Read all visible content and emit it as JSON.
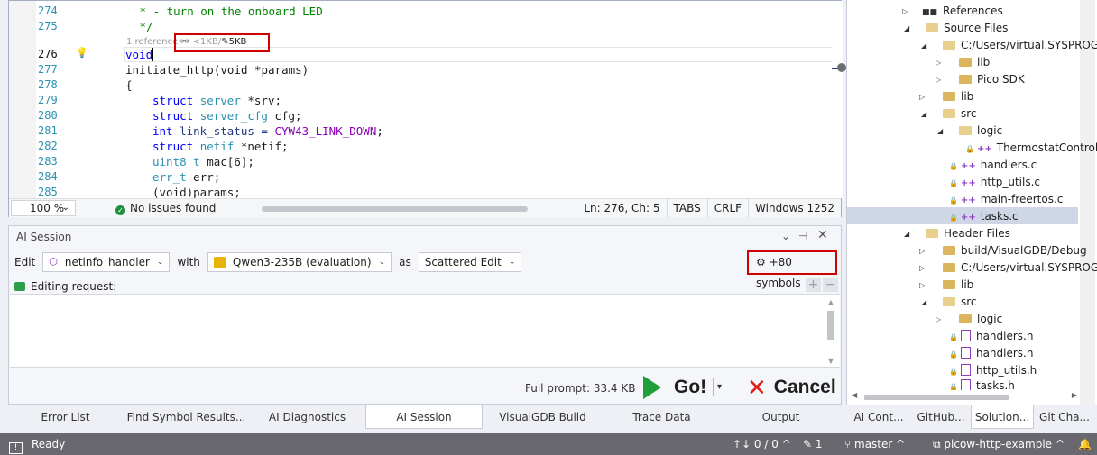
{
  "editor": {
    "line_numbers": [
      "274",
      "275",
      "276",
      "277",
      "278",
      "279",
      "280",
      "281",
      "282",
      "283",
      "284",
      "285"
    ],
    "code_lens": {
      "references": "1 reference",
      "size_before": "<1KB",
      "size_after": "5KB"
    },
    "code": {
      "l274": " * - turn on the onboard LED",
      "l275": " */",
      "l276": "void",
      "l277_fn": "initiate_http",
      "l277_rest": "(void *params)",
      "l278": "{",
      "l279_kw": "struct",
      "l279_ty": "server",
      "l279_rest": " *srv;",
      "l280_kw": "struct",
      "l280_ty": "server_cfg",
      "l280_rest": " cfg;",
      "l281_kw": "int",
      "l281_var": " link_status = ",
      "l281_macro": "CYW43_LINK_DOWN",
      "l281_end": ";",
      "l282_kw": "struct",
      "l282_ty": "netif",
      "l282_rest": " *netif;",
      "l283_ty": "uint8_t",
      "l283_rest": " mac[6];",
      "l284_ty": "err_t",
      "l284_rest": " err;",
      "l285": "(void)params;"
    },
    "status": {
      "zoom": "100 %",
      "issues": "No issues found",
      "position": "Ln: 276, Ch: 5",
      "indent": "TABS",
      "line_ending": "CRLF",
      "encoding": "Windows 1252"
    }
  },
  "ai_session": {
    "title": "AI Session",
    "edit_label": "Edit",
    "symbol": "netinfo_handler",
    "with_label": "with",
    "model": "Qwen3-235B (evaluation)",
    "as_label": "as",
    "mode": "Scattered Edit",
    "symbols_button": "+80 symbols",
    "editing_request": "Editing request:",
    "full_prompt": "Full prompt: 33.4 KB",
    "go_label": "Go!",
    "cancel_label": "Cancel"
  },
  "bottom_tabs": [
    "Error List",
    "Find Symbol Results...",
    "AI Diagnostics",
    "AI Session",
    "VisualGDB Build",
    "Trace Data",
    "Output"
  ],
  "solution_explorer": {
    "items": {
      "references": "References",
      "source_files": "Source Files",
      "users_path": "C:/Users/virtual.SYSPROG",
      "lib1": "lib",
      "pico_sdk": "Pico SDK",
      "lib2": "lib",
      "src": "src",
      "logic": "logic",
      "thermostat": "ThermostatController",
      "handlers_c": "handlers.c",
      "http_utils_c": "http_utils.c",
      "main_freertos_c": "main-freertos.c",
      "tasks_c": "tasks.c",
      "header_files": "Header Files",
      "build_debug": "build/VisualGDB/Debug",
      "users_path2": "C:/Users/virtual.SYSPROG",
      "lib3": "lib",
      "src2": "src",
      "logic2": "logic",
      "handlers_h1": "handlers.h",
      "handlers_h2": "handlers.h",
      "http_utils_h": "http_utils.h",
      "tasks_h": "tasks.h"
    },
    "tabs": [
      "AI Cont...",
      "GitHub...",
      "Solution...",
      "Git Cha..."
    ]
  },
  "statusbar": {
    "ready": "Ready",
    "changes": "↑↓ 0 / 0 ^",
    "edits": "1",
    "branch": "master",
    "repo": "picow-http-example"
  },
  "colors": {
    "highlight_box": "#d00000",
    "go_green": "#1f9e3a",
    "cancel_red": "#e0201b",
    "statusbar_bg": "#68686e"
  }
}
